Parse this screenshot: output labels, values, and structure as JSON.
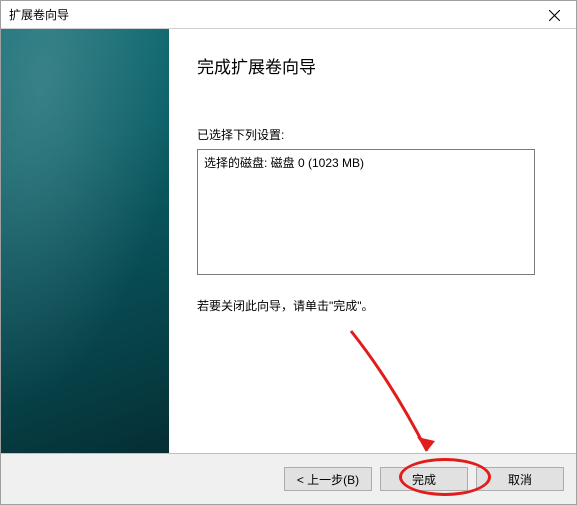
{
  "titlebar": {
    "title": "扩展卷向导"
  },
  "main": {
    "heading": "完成扩展卷向导",
    "selected_label": "已选择下列设置:",
    "settings_text": "选择的磁盘: 磁盘 0 (1023 MB)",
    "close_hint": "若要关闭此向导，请单击\"完成\"。"
  },
  "footer": {
    "back": "< 上一步(B)",
    "finish": "完成",
    "cancel": "取消"
  }
}
